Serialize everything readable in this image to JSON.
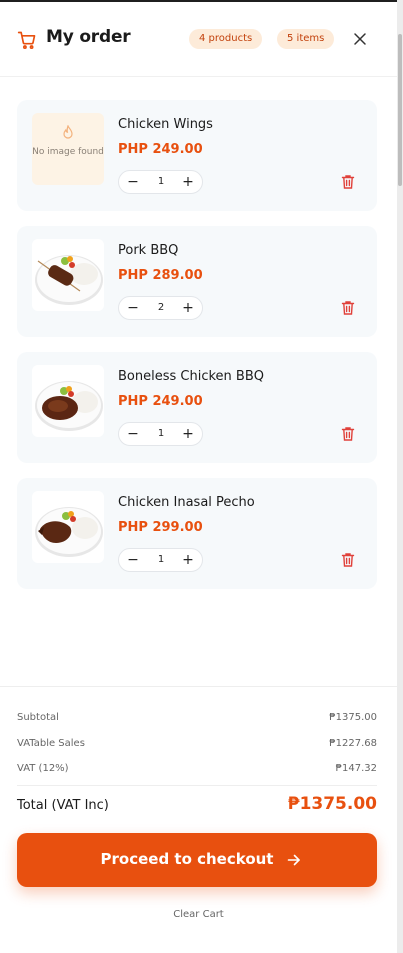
{
  "header": {
    "title": "My order",
    "products_badge": "4 products",
    "items_badge": "5 items",
    "icons": {
      "cart": "cart-icon",
      "close": "close-icon"
    }
  },
  "items": [
    {
      "name": "Chicken Wings",
      "price": "PHP 249.00",
      "qty": "1",
      "image": "no-image-placeholder",
      "no_image_text": "No image found"
    },
    {
      "name": "Pork BBQ",
      "price": "PHP 289.00",
      "qty": "2",
      "image": "pork-bbq-plate"
    },
    {
      "name": "Boneless Chicken BBQ",
      "price": "PHP 249.00",
      "qty": "1",
      "image": "boneless-chicken-bbq-plate"
    },
    {
      "name": "Chicken Inasal Pecho",
      "price": "PHP 299.00",
      "qty": "1",
      "image": "chicken-inasal-plate"
    }
  ],
  "summary": {
    "subtotal_label": "Subtotal",
    "subtotal_value": "₱1375.00",
    "vatable_label": "VATable Sales",
    "vatable_value": "₱1227.68",
    "vat_label": "VAT (12%)",
    "vat_value": "₱147.32",
    "total_label": "Total (VAT Inc)",
    "total_value": "₱1375.00"
  },
  "actions": {
    "checkout_label": "Proceed to checkout",
    "clear_cart_label": "Clear Cart"
  },
  "colors": {
    "accent": "#e8500f",
    "badge_bg": "#fdebd9",
    "card_bg": "#f6f9fb",
    "trash": "#e0413a"
  }
}
